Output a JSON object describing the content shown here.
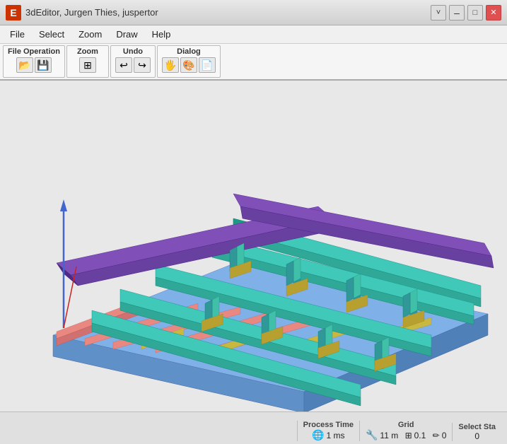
{
  "titleBar": {
    "appIcon": "E",
    "title": "3dEditor, Jurgen Thies, juspertor",
    "minimizeBtn": "–",
    "maximizeBtn": "□",
    "closeBtn": "✕",
    "chevronBtn": "˅"
  },
  "menuBar": {
    "items": [
      "File",
      "Select",
      "Zoom",
      "Draw",
      "Help"
    ]
  },
  "toolbar": {
    "groups": [
      {
        "label": "File Operation",
        "buttons": [
          "📂",
          "💾"
        ]
      },
      {
        "label": "Zoom",
        "buttons": [
          "⊞"
        ]
      },
      {
        "label": "Undo",
        "buttons": [
          "↩",
          "↪"
        ]
      },
      {
        "label": "Dialog",
        "buttons": [
          "🖐",
          "🎨",
          "📄"
        ]
      }
    ]
  },
  "statusBar": {
    "processTime": {
      "label": "Process Time",
      "icon": "🌐",
      "value": "1 ms"
    },
    "grid": {
      "label": "Grid",
      "icon": "🔧",
      "value": "11 m",
      "gridIcon": "⊞",
      "gridValue": "0.1",
      "pencilIcon": "✏",
      "pencilValue": "0"
    },
    "selectStatus": {
      "label": "Select Sta",
      "value": "0"
    }
  }
}
